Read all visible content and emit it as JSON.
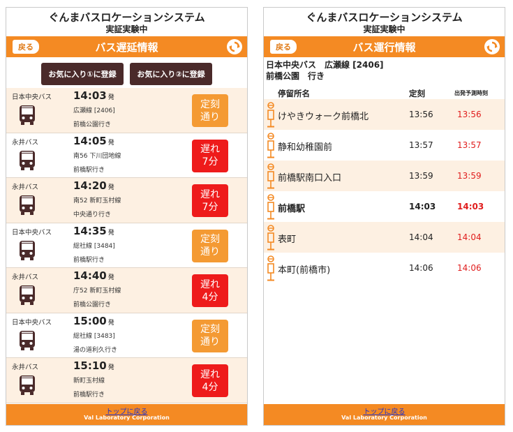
{
  "app": {
    "system_title": "ぐんまバスロケーションシステム",
    "system_subtitle": "実証実験中",
    "back_label": "戻る",
    "footer_link": "トップに戻る",
    "footer_copyright": "Val Laboratory Corporation"
  },
  "left": {
    "title": "バス遅延情報",
    "fav_buttons": [
      "お気に入り①に登録",
      "お気に入り②に登録"
    ],
    "departure_suffix": "発",
    "buses": [
      {
        "company": "日本中央バス",
        "time": "14:03",
        "route": "広瀬線 [2406]",
        "destination": "前橋公園行き",
        "status": "定刻\n通り",
        "status_type": "ontime"
      },
      {
        "company": "永井バス",
        "time": "14:05",
        "route": "南56 下川団地線",
        "destination": "前橋駅行き",
        "status": "遅れ\n7分",
        "status_type": "late"
      },
      {
        "company": "永井バス",
        "time": "14:20",
        "route": "南52 新町玉村線",
        "destination": "中央通り行き",
        "status": "遅れ\n7分",
        "status_type": "late"
      },
      {
        "company": "日本中央バス",
        "time": "14:35",
        "route": "総社線 [3484]",
        "destination": "前橋駅行き",
        "status": "定刻\n通り",
        "status_type": "ontime"
      },
      {
        "company": "永井バス",
        "time": "14:40",
        "route": "庁52 新町玉村線",
        "destination": "前橋公園行き",
        "status": "遅れ\n4分",
        "status_type": "late"
      },
      {
        "company": "日本中央バス",
        "time": "15:00",
        "route": "総社線 [3483]",
        "destination": "湯の道利久行き",
        "status": "定刻\n通り",
        "status_type": "ontime"
      },
      {
        "company": "永井バス",
        "time": "15:10",
        "route": "新町玉村線",
        "destination": "前橋駅行き",
        "status": "遅れ\n4分",
        "status_type": "late"
      }
    ]
  },
  "right": {
    "title": "バス運行情報",
    "line_info": "日本中央バス　広瀬線 [2406]",
    "line_dest": "前橋公園　行き",
    "headers": {
      "stop": "停留所名",
      "scheduled": "定刻",
      "predicted": "出発予測時刻"
    },
    "stops": [
      {
        "name": "けやきウォーク前橋北",
        "scheduled": "13:56",
        "predicted": "13:56",
        "bold": false
      },
      {
        "name": "静和幼稚園前",
        "scheduled": "13:57",
        "predicted": "13:57",
        "bold": false
      },
      {
        "name": "前橋駅南口入口",
        "scheduled": "13:59",
        "predicted": "13:59",
        "bold": false
      },
      {
        "name": "前橋駅",
        "scheduled": "14:03",
        "predicted": "14:03",
        "bold": true
      },
      {
        "name": "表町",
        "scheduled": "14:04",
        "predicted": "14:04",
        "bold": false
      },
      {
        "name": "本町(前橋市)",
        "scheduled": "14:06",
        "predicted": "14:06",
        "bold": false
      }
    ]
  },
  "colors": {
    "accent": "#f48a23",
    "late": "#ee1b1b",
    "ontime": "#f49a33",
    "row_tint": "#fdf0e2",
    "dark_button": "#4a2a2a",
    "marker": "#f48a23",
    "bus_icon": "#4a2a2a"
  }
}
